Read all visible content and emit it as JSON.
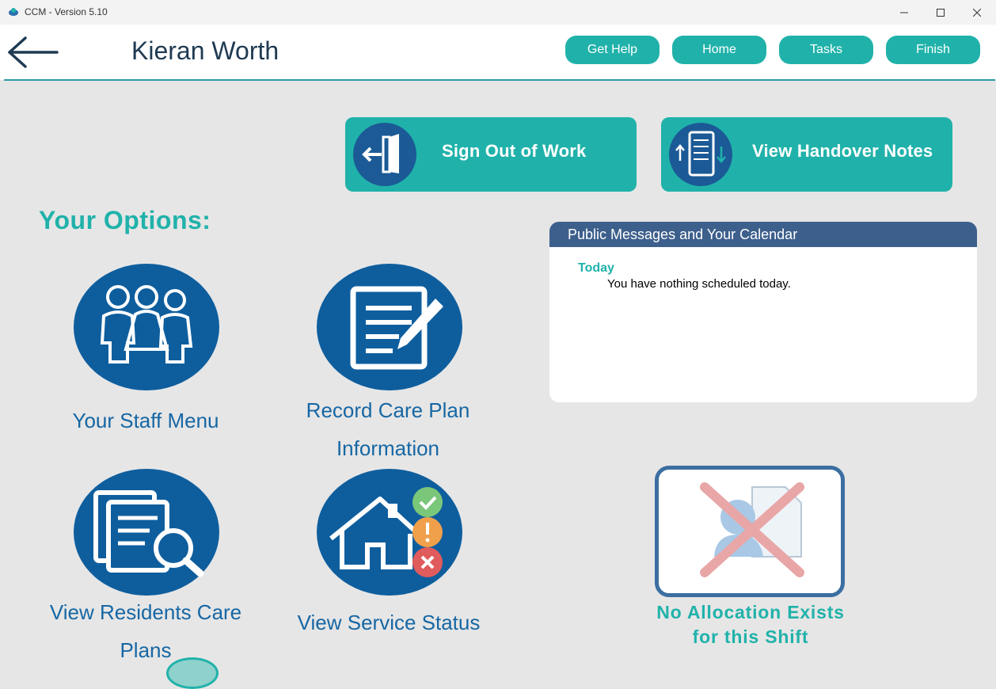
{
  "window": {
    "title": "CCM - Version 5.10"
  },
  "header": {
    "user_name": "Kieran Worth",
    "buttons": {
      "help": "Get Help",
      "home": "Home",
      "tasks": "Tasks",
      "finish": "Finish"
    }
  },
  "actions": {
    "sign_out": "Sign Out of Work",
    "handover": "View Handover Notes"
  },
  "options": {
    "title": "Your Options:",
    "staff_menu": "Your Staff Menu",
    "record_care_plan": [
      "Record Care Plan",
      "Information"
    ],
    "view_care_plans": [
      "View Residents Care",
      "Plans"
    ],
    "service_status": "View Service Status"
  },
  "messages": {
    "title": "Public Messages and Your Calendar",
    "today_label": "Today",
    "today_text": "You have nothing scheduled today."
  },
  "allocation": {
    "lines": [
      "No Allocation Exists",
      "for this Shift"
    ]
  },
  "colors": {
    "teal": "#20b2aa",
    "navy": "#0e5e9e",
    "panel_header": "#3d5f8c"
  }
}
